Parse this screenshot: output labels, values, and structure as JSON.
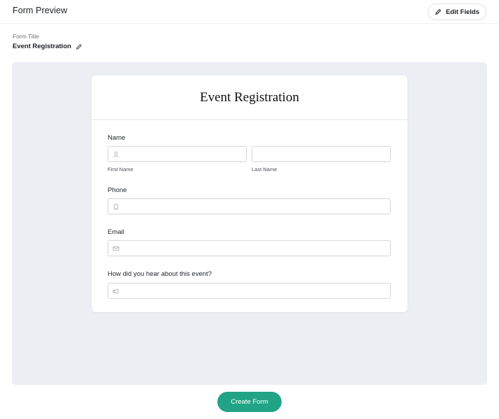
{
  "header": {
    "title": "Form Preview",
    "edit_button_label": "Edit Fields"
  },
  "form_title": {
    "label": "Form Title",
    "value": "Event Registration"
  },
  "form": {
    "title": "Event Registration",
    "fields": {
      "name": {
        "label": "Name",
        "first_sub": "First Name",
        "last_sub": "Last Name"
      },
      "phone": {
        "label": "Phone"
      },
      "email": {
        "label": "Email"
      },
      "source": {
        "label": "How did you hear about this event?"
      }
    }
  },
  "actions": {
    "create_label": "Create Form"
  },
  "colors": {
    "accent": "#22a386",
    "canvas": "#eceef3"
  },
  "icons": [
    "pencil-icon",
    "user-icon",
    "phone-icon",
    "mail-icon",
    "megaphone-icon"
  ]
}
